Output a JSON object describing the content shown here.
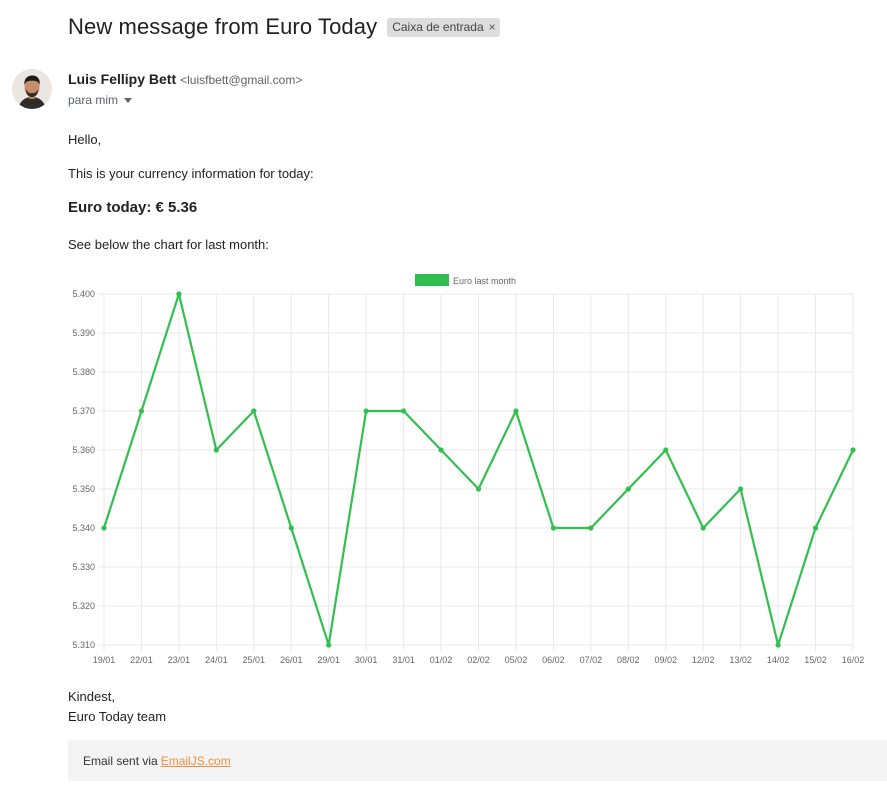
{
  "email": {
    "subject": "New message from Euro Today",
    "label": "Caixa de entrada",
    "label_close": "×",
    "sender_name": "Luis Fellipy Bett",
    "sender_email": "<luisfbett@gmail.com>",
    "to": "para mim",
    "greeting": "Hello,",
    "intro": "This is your currency information for today:",
    "euro_today": "Euro today: € 5.36",
    "chart_intro": "See below the chart for last month:",
    "sign_1": "Kindest,",
    "sign_2": "Euro Today team",
    "footer_prefix": "Email sent via",
    "footer_link": "EmailJS.com"
  },
  "colors": {
    "line": "#32bf4f",
    "grid": "#e8e8e8",
    "chip": "#dddddd",
    "link": "#f28d3b"
  },
  "chart_data": {
    "type": "line",
    "legend": "Euro last month",
    "legend_position": "top-center",
    "grid": true,
    "x": [
      "19/01",
      "22/01",
      "23/01",
      "24/01",
      "25/01",
      "26/01",
      "29/01",
      "30/01",
      "31/01",
      "01/02",
      "02/02",
      "05/02",
      "06/02",
      "07/02",
      "08/02",
      "09/02",
      "12/02",
      "13/02",
      "14/02",
      "15/02",
      "16/02"
    ],
    "series": [
      {
        "name": "Euro last month",
        "values": [
          5.34,
          5.37,
          5.4,
          5.36,
          5.37,
          5.34,
          5.31,
          5.37,
          5.37,
          5.36,
          5.35,
          5.37,
          5.34,
          5.34,
          5.35,
          5.36,
          5.34,
          5.35,
          5.31,
          5.34,
          5.36
        ]
      }
    ],
    "ylim": [
      5.31,
      5.4
    ],
    "yticks": [
      "5.400",
      "5.390",
      "5.380",
      "5.370",
      "5.360",
      "5.350",
      "5.340",
      "5.330",
      "5.320",
      "5.310"
    ]
  }
}
